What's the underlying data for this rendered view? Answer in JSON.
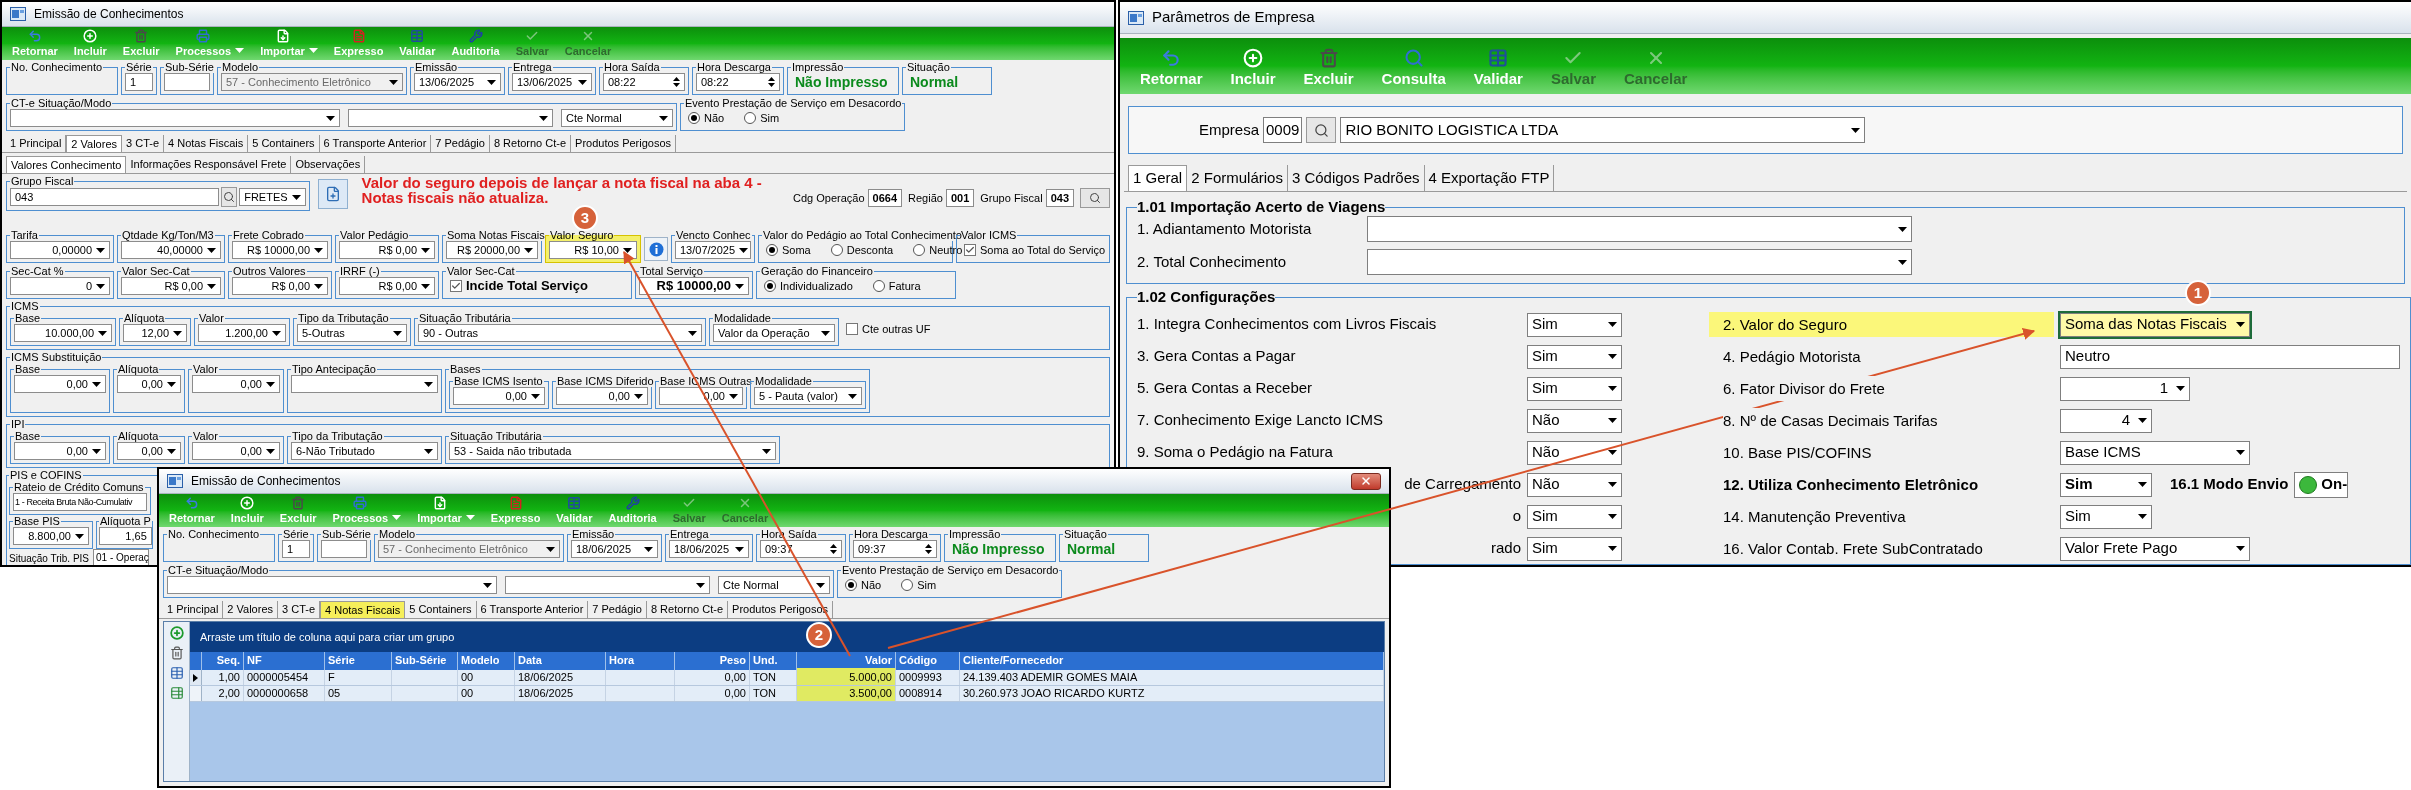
{
  "left_window": {
    "title": "Emissão de Conhecimentos",
    "toolbar": [
      {
        "label": "Retornar",
        "kind": "back",
        "disabled": false,
        "dropdown": false
      },
      {
        "label": "Incluir",
        "kind": "add",
        "disabled": false,
        "dropdown": false
      },
      {
        "label": "Excluir",
        "kind": "delete",
        "disabled": false,
        "dropdown": false
      },
      {
        "label": "Processos",
        "kind": "print",
        "disabled": false,
        "dropdown": true
      },
      {
        "label": "Importar",
        "kind": "import",
        "disabled": false,
        "dropdown": true
      },
      {
        "label": "Expresso",
        "kind": "express",
        "disabled": false,
        "dropdown": false
      },
      {
        "label": "Validar",
        "kind": "validate",
        "disabled": false,
        "dropdown": false
      },
      {
        "label": "Auditoria",
        "kind": "audit",
        "disabled": false,
        "dropdown": false
      },
      {
        "label": "Salvar",
        "kind": "save",
        "disabled": true,
        "dropdown": false
      },
      {
        "label": "Cancelar",
        "kind": "cancel",
        "disabled": true,
        "dropdown": false
      }
    ],
    "header": [
      {
        "label": "No. Conhecimento",
        "kind": "blank"
      },
      {
        "label": "Série",
        "kind": "text",
        "value": "1"
      },
      {
        "label": "Sub-Série",
        "kind": "text"
      },
      {
        "label": "Modelo",
        "kind": "locked",
        "value": "57 - Conhecimento Eletrônico"
      },
      {
        "label": "Emissão",
        "kind": "date",
        "value": "13/06/2025"
      },
      {
        "label": "Entrega",
        "kind": "date",
        "value": "13/06/2025"
      },
      {
        "label": "Hora Saída",
        "kind": "spin",
        "value": "08:22"
      },
      {
        "label": "Hora Descarga",
        "kind": "spin",
        "value": "08:22"
      },
      {
        "label": "Impressão",
        "kind": "status",
        "value": "Não Impresso"
      },
      {
        "label": "Situação",
        "kind": "status",
        "value": "Normal"
      }
    ],
    "cte": {
      "label": "CT-e Situação/Modo",
      "combos": [
        {
          "kind": "combo"
        },
        {
          "kind": "combo"
        },
        {
          "kind": "combo",
          "value": "Cte Normal"
        }
      ]
    },
    "evento": {
      "label": "Evento Prestação de Serviço em Desacordo",
      "kind": "radio",
      "options": [
        {
          "label": "Não",
          "selected": true
        },
        {
          "label": "Sim",
          "selected": false
        }
      ]
    },
    "tabs": [
      {
        "label": "1 Principal",
        "selected": false
      },
      {
        "label": "2 Valores",
        "selected": true
      },
      {
        "label": "3 CT-e",
        "selected": false
      },
      {
        "label": "4 Notas Fiscais",
        "selected": false
      },
      {
        "label": "5 Containers",
        "selected": false
      },
      {
        "label": "6 Transporte Anterior",
        "selected": false
      },
      {
        "label": "7 Pedágio",
        "selected": false
      },
      {
        "label": "8 Retorno Ct-e",
        "selected": false
      },
      {
        "label": "Produtos Perigosos",
        "selected": false
      }
    ],
    "subtabs": [
      {
        "label": "Valores Conhecimento",
        "selected": true
      },
      {
        "label": "Informações Responsável Frete",
        "selected": false
      },
      {
        "label": "Observações",
        "selected": false
      }
    ],
    "grupo_fiscal": {
      "label": "Grupo Fiscal",
      "code": "043",
      "value": "FRETES"
    },
    "note": "Valor do seguro depois de lançar a nota fiscal na aba 4 - Notas fiscais não atualiza.",
    "codes": [
      {
        "label": "Cdg Operação",
        "value": "0664"
      },
      {
        "label": "Região",
        "value": "001"
      },
      {
        "label": "Grupo Fiscal",
        "value": "043"
      }
    ],
    "values_rows": [
      [
        {
          "label": "Tarifa",
          "kind": "number",
          "value": "0,00000",
          "highlighted": false
        },
        {
          "label": "Qtdade Kg/Ton/M3",
          "kind": "number",
          "value": "40,00000",
          "highlighted": false
        },
        {
          "label": "Frete Cobrado",
          "kind": "number",
          "value": "R$ 10000,00",
          "highlighted": false
        },
        {
          "label": "Valor Pedágio",
          "kind": "number",
          "value": "R$ 0,00",
          "highlighted": false
        },
        {
          "label": "Soma Notas Fiscais",
          "kind": "number",
          "value": "R$ 20000,00",
          "highlighted": false
        },
        {
          "label": "Valor Seguro",
          "kind": "number",
          "value": "R$ 10,00",
          "highlighted": true
        },
        {
          "kind": "info",
          "highlighted": false
        },
        {
          "label": "Vencto Conhec",
          "kind": "date",
          "value": "13/07/2025",
          "highlighted": false
        },
        {
          "label": "Valor do Pedágio ao Total Conhecimento",
          "kind": "radio",
          "options": [
            {
              "label": "Soma",
              "selected": true
            },
            {
              "label": "Desconta",
              "selected": false
            },
            {
              "label": "Neutro",
              "selected": false
            }
          ],
          "highlighted": false
        },
        {
          "label": "Valor ICMS",
          "kind": "check",
          "text": "Soma ao Total do Serviço",
          "checked": true,
          "highlighted": false
        }
      ],
      [
        {
          "label": "Sec-Cat %",
          "kind": "number",
          "value": "0"
        },
        {
          "label": "Valor Sec-Cat",
          "kind": "number",
          "value": "R$ 0,00"
        },
        {
          "label": "Outros Valores",
          "kind": "number",
          "value": "R$ 0,00"
        },
        {
          "label": "IRRF (-)",
          "kind": "number",
          "value": "R$ 0,00"
        },
        {
          "label": "Valor Sec-Cat",
          "kind": "check_bold",
          "text": "Incide Total Serviço",
          "checked": true
        },
        {
          "label": "Total Serviço",
          "kind": "bold_number",
          "value": "R$ 10000,00"
        },
        {
          "label": "Geração do Financeiro",
          "kind": "radio",
          "options": [
            {
              "label": "Individualizado",
              "selected": true
            },
            {
              "label": "Fatura",
              "selected": false
            }
          ]
        }
      ]
    ],
    "sections": [
      {
        "title": "ICMS",
        "fields": [
          {
            "label": "Base",
            "kind": "number",
            "value": "10.000,00"
          },
          {
            "label": "Alíquota",
            "kind": "number",
            "value": "12,00"
          },
          {
            "label": "Valor",
            "kind": "number",
            "value": "1.200,00"
          },
          {
            "label": "Tipo da Tributação",
            "kind": "combo",
            "value": "5-Outras"
          },
          {
            "label": "Situação Tributária",
            "kind": "combo",
            "value": "90 - Outras"
          },
          {
            "label": "Modalidade",
            "kind": "combo",
            "value": "Valor da Operação"
          },
          {
            "kind": "check",
            "text": "Cte outras UF",
            "checked": false
          }
        ]
      },
      {
        "title": "ICMS Substituição",
        "fields": [
          {
            "label": "Base",
            "kind": "number",
            "value": "0,00"
          },
          {
            "label": "Alíquota",
            "kind": "number",
            "value": "0,00"
          },
          {
            "label": "Valor",
            "kind": "number",
            "value": "0,00"
          },
          {
            "label": "Tipo Antecipação",
            "kind": "combo"
          },
          {
            "label": "Bases",
            "kind": "group",
            "fields": [
              {
                "label": "Base ICMS Isento",
                "kind": "number",
                "value": "0,00"
              },
              {
                "label": "Base ICMS Diferido",
                "kind": "number",
                "value": "0,00"
              },
              {
                "label": "Base ICMS Outras",
                "kind": "number",
                "value": "0,00"
              },
              {
                "label": "Modalidade",
                "kind": "combo",
                "value": "5 - Pauta (valor)"
              }
            ]
          }
        ]
      },
      {
        "title": "IPI",
        "fields": [
          {
            "label": "Base",
            "kind": "number",
            "value": "0,00"
          },
          {
            "label": "Alíquota",
            "kind": "number",
            "value": "0,00"
          },
          {
            "label": "Valor",
            "kind": "number",
            "value": "0,00"
          },
          {
            "label": "Tipo da Tributação",
            "kind": "combo",
            "value": "6-Não Tributado"
          },
          {
            "label": "Situação Tributária",
            "kind": "combo",
            "value": "53 - Saida não tributada"
          }
        ]
      }
    ],
    "pis": {
      "title": "PIS e COFINS",
      "rateio": {
        "label": "Rateio de Crédito Comuns",
        "value": "1 - Receita Bruta Não-Cumulativ"
      },
      "base": {
        "label": "Base PIS",
        "value": "8.800,00"
      },
      "aliquota": {
        "label": "Alíquota P",
        "value": "1,65"
      },
      "situacao": {
        "label": "Situação Trib. PIS",
        "value": "01 - Operaç"
      }
    }
  },
  "right_window": {
    "title": "Parâmetros de Empresa",
    "toolbar": [
      {
        "label": "Retornar",
        "kind": "back",
        "disabled": false,
        "dropdown": false
      },
      {
        "label": "Incluir",
        "kind": "add",
        "disabled": false,
        "dropdown": false
      },
      {
        "label": "Excluir",
        "kind": "delete",
        "disabled": false,
        "dropdown": false
      },
      {
        "label": "Consulta",
        "kind": "search",
        "disabled": false,
        "dropdown": false
      },
      {
        "label": "Validar",
        "kind": "validate",
        "disabled": false,
        "dropdown": false
      },
      {
        "label": "Salvar",
        "kind": "save",
        "disabled": true,
        "dropdown": false
      },
      {
        "label": "Cancelar",
        "kind": "cancel",
        "disabled": true,
        "dropdown": false
      }
    ],
    "empresa": {
      "label": "Empresa",
      "code": "0009",
      "value": "RIO BONITO LOGISTICA LTDA"
    },
    "tabs": [
      {
        "label": "1 Geral",
        "selected": true
      },
      {
        "label": "2 Formulários",
        "selected": false
      },
      {
        "label": "3 Códigos Padrões",
        "selected": false
      },
      {
        "label": "4 Exportação FTP",
        "selected": false
      }
    ],
    "section_1": {
      "title": "1.01 Importação Acerto de Viagens",
      "rows": [
        {
          "label": "1. Adiantamento Motorista"
        },
        {
          "label": "2. Total Conhecimento"
        }
      ]
    },
    "section_2": {
      "title": "1.02 Configurações",
      "left": [
        {
          "label": "1. Integra Conhecimentos com Livros Fiscais",
          "value": "Sim",
          "cut": false
        },
        {
          "label": "3. Gera Contas a Pagar",
          "value": "Sim",
          "cut": false
        },
        {
          "label": "5. Gera Contas a Receber",
          "value": "Sim",
          "cut": false
        },
        {
          "label": "7. Conhecimento Exige Lancto ICMS",
          "value": "Não",
          "cut": false
        },
        {
          "label": "9. Soma o Pedágio na Fatura",
          "value": "Não",
          "cut": false
        },
        {
          "label": "de Carregamento",
          "value": "Não",
          "cut": true
        },
        {
          "label": "o",
          "value": "Sim",
          "cut": true
        },
        {
          "label": "rado",
          "value": "Sim",
          "cut": true
        }
      ],
      "right": [
        {
          "label": "2. Valor do Seguro",
          "value": "Soma das Notas Fiscais",
          "kind": "combo",
          "bold": false,
          "highlighted": true
        },
        {
          "label": "4. Pedágio Motorista",
          "value": "Neutro",
          "kind": "text",
          "bold": false,
          "highlighted": false
        },
        {
          "label": "6. Fator Divisor do Frete",
          "value": "1",
          "kind": "number",
          "bold": false,
          "highlighted": false
        },
        {
          "label": "8. Nº de Casas Decimais Tarifas",
          "value": "4",
          "kind": "number",
          "bold": false,
          "highlighted": false
        },
        {
          "label": "10. Base PIS/COFINS",
          "value": "Base ICMS",
          "kind": "combo",
          "bold": false,
          "highlighted": false
        },
        {
          "label": "12. Utiliza Conhecimento Eletrônico",
          "value": "Sim",
          "kind": "combo",
          "bold": true,
          "highlighted": false,
          "extra_label": "16.1 Modo Envio",
          "extra_value": "On-"
        },
        {
          "label": "14. Manutenção Preventiva",
          "value": "Sim",
          "kind": "combo",
          "bold": false,
          "highlighted": false
        },
        {
          "label": "16. Valor Contab. Frete SubContratado",
          "value": "Valor Frete Pago",
          "kind": "combo",
          "bold": false,
          "highlighted": false
        }
      ]
    }
  },
  "bottom_window": {
    "title": "Emissão de Conhecimentos",
    "toolbar": [
      {
        "label": "Retornar",
        "kind": "back",
        "disabled": false,
        "dropdown": false
      },
      {
        "label": "Incluir",
        "kind": "add",
        "disabled": false,
        "dropdown": false
      },
      {
        "label": "Excluir",
        "kind": "delete",
        "disabled": false,
        "dropdown": false
      },
      {
        "label": "Processos",
        "kind": "print",
        "disabled": false,
        "dropdown": true
      },
      {
        "label": "Importar",
        "kind": "import",
        "disabled": false,
        "dropdown": true
      },
      {
        "label": "Expresso",
        "kind": "express",
        "disabled": false,
        "dropdown": false
      },
      {
        "label": "Validar",
        "kind": "validate",
        "disabled": false,
        "dropdown": false
      },
      {
        "label": "Auditoria",
        "kind": "audit",
        "disabled": false,
        "dropdown": false
      },
      {
        "label": "Salvar",
        "kind": "save",
        "disabled": true,
        "dropdown": false
      },
      {
        "label": "Cancelar",
        "kind": "cancel",
        "disabled": true,
        "dropdown": false
      }
    ],
    "header": [
      {
        "label": "No. Conhecimento",
        "kind": "blank"
      },
      {
        "label": "Série",
        "kind": "text",
        "value": "1"
      },
      {
        "label": "Sub-Série",
        "kind": "text"
      },
      {
        "label": "Modelo",
        "kind": "locked",
        "value": "57 - Conhecimento Eletrônico"
      },
      {
        "label": "Emissão",
        "kind": "date",
        "value": "18/06/2025"
      },
      {
        "label": "Entrega",
        "kind": "date",
        "value": "18/06/2025"
      },
      {
        "label": "Hora Saída",
        "kind": "spin",
        "value": "09:37"
      },
      {
        "label": "Hora Descarga",
        "kind": "spin",
        "value": "09:37"
      },
      {
        "label": "Impressão",
        "kind": "status",
        "value": "Não Impresso"
      },
      {
        "label": "Situação",
        "kind": "status",
        "value": "Normal"
      }
    ],
    "cte": {
      "label": "CT-e Situação/Modo",
      "combos": [
        {
          "kind": "combo"
        },
        {
          "kind": "combo"
        },
        {
          "kind": "combo",
          "value": "Cte Normal"
        }
      ]
    },
    "evento": {
      "label": "Evento Prestação de Serviço em Desacordo",
      "kind": "radio",
      "options": [
        {
          "label": "Não",
          "selected": true
        },
        {
          "label": "Sim",
          "selected": false
        }
      ]
    },
    "tabs": [
      {
        "label": "1 Principal",
        "selected": false
      },
      {
        "label": "2 Valores",
        "selected": false
      },
      {
        "label": "3 CT-e",
        "selected": false
      },
      {
        "label": "4 Notas Fiscais",
        "selected": true
      },
      {
        "label": "5 Containers",
        "selected": false
      },
      {
        "label": "6 Transporte Anterior",
        "selected": false
      },
      {
        "label": "7 Pedágio",
        "selected": false
      },
      {
        "label": "8 Retorno Ct-e",
        "selected": false
      },
      {
        "label": "Produtos Perigosos",
        "selected": false
      }
    ],
    "grid": {
      "group_hint": "Arraste um título de coluna aqui para criar um grupo",
      "columns": [
        {
          "label": "Seq.",
          "highlighted": false
        },
        {
          "label": "NF",
          "highlighted": false
        },
        {
          "label": "Série",
          "highlighted": false
        },
        {
          "label": "Sub-Série",
          "highlighted": false
        },
        {
          "label": "Modelo",
          "highlighted": false
        },
        {
          "label": "Data",
          "highlighted": false
        },
        {
          "label": "Hora",
          "highlighted": false
        },
        {
          "label": "Peso",
          "highlighted": false
        },
        {
          "label": "Und.",
          "highlighted": false
        },
        {
          "label": "Valor",
          "highlighted": true
        },
        {
          "label": "Código",
          "highlighted": false
        },
        {
          "label": "Cliente/Fornecedor",
          "highlighted": false
        }
      ],
      "rows": [
        {
          "selected": true,
          "cells": [
            "1,00",
            "0000005454",
            "F",
            null,
            "00",
            "18/06/2025",
            null,
            "0,00",
            "TON",
            "5.000,00",
            "0009993",
            "24.139.403 ADEMIR GOMES MAIA"
          ]
        },
        {
          "selected": false,
          "cells": [
            "2,00",
            "0000000658",
            "05",
            null,
            "00",
            "18/06/2025",
            null,
            "0,00",
            "TON",
            "3.500,00",
            "0008914",
            "30.260.973 JOAO RICARDO KURTZ"
          ]
        }
      ]
    }
  },
  "badges": [
    {
      "label": "3"
    },
    {
      "label": "1"
    },
    {
      "label": "2"
    }
  ]
}
